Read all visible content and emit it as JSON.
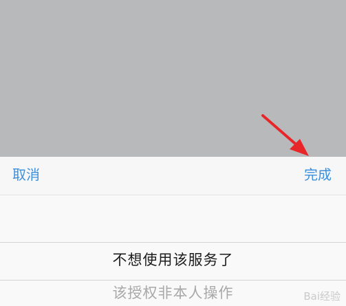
{
  "toolbar": {
    "cancel_label": "取消",
    "done_label": "完成"
  },
  "picker": {
    "selected_item": "不想使用该服务了",
    "next_item": "该授权非本人操作"
  },
  "watermark": {
    "text": "Bai经验"
  },
  "colors": {
    "overlay": "#b8b9bb",
    "accent": "#3a8fde",
    "arrow": "#e8262a"
  }
}
